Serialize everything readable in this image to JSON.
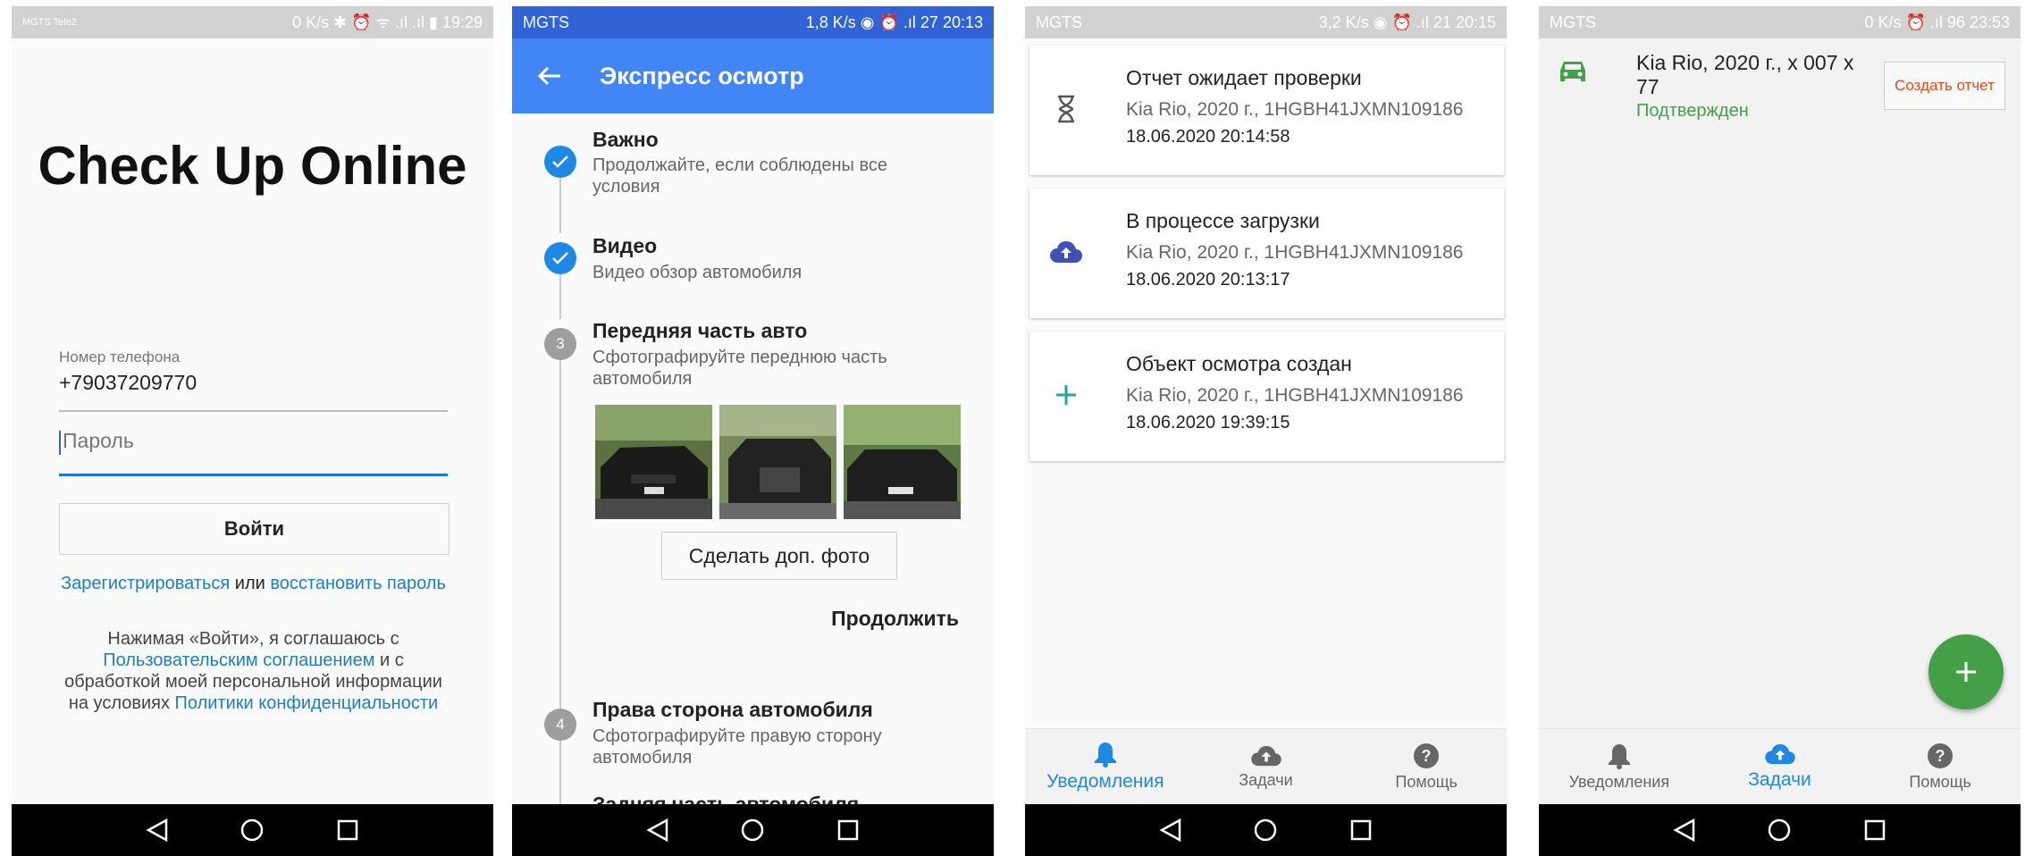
{
  "screens": [
    {
      "status": {
        "left": "MGTS Tele2",
        "right": "0 K/s ✱ ⏰ ᯤ .ıl .ıl ▮ 19:29"
      },
      "logo": "Check Up Online",
      "phone_label": "Номер телефона",
      "phone_value": "+79037209770",
      "password_placeholder": "Пароль",
      "login_button": "Войти",
      "register_link": "Зарегистрироваться",
      "or_text": " или ",
      "restore_link": "восстановить пароль",
      "agree_text_1": "Нажимая «Войти», я соглашаюсь с ",
      "agree_link_1": "Пользовательским соглашением",
      "agree_text_2": " и с обработкой моей персональной информации на условиях ",
      "agree_link_2": "Политики конфиденциальности"
    },
    {
      "status": {
        "left": "MGTS",
        "right": "1,8 K/s ◉ ⏰ .ıl 27 20:13"
      },
      "title": "Экспресс осмотр",
      "steps": [
        {
          "title": "Важно",
          "subtitle": "Продолжайте, если соблюдены все условия"
        },
        {
          "title": "Видео",
          "subtitle": "Видео обзор автомобиля"
        },
        {
          "number": "3",
          "title": "Передняя часть авто",
          "subtitle": "Сфотографируйте переднюю часть автомобиля"
        },
        {
          "number": "4",
          "title": "Права сторона автомобиля",
          "subtitle": "Сфотографируйте правую сторону автомобиля"
        },
        {
          "title": "Задняя часть автомобиля"
        }
      ],
      "extra_photo_button": "Сделать доп. фото",
      "continue_button": "Продолжить"
    },
    {
      "status": {
        "left": "MGTS",
        "right": "3,2 K/s ◉ ⏰ .ıl 21 20:15"
      },
      "cards": [
        {
          "icon": "hourglass-icon",
          "title": "Отчет ожидает проверки",
          "subtitle": "Kia Rio, 2020 г., 1HGBH41JXMN109186",
          "date": "18.06.2020 20:14:58"
        },
        {
          "icon": "cloud-upload-icon",
          "title": "В процессе загрузки",
          "subtitle": "Kia Rio, 2020 г., 1HGBH41JXMN109186",
          "date": "18.06.2020 20:13:17"
        },
        {
          "icon": "plus-icon",
          "title": "Объект осмотра создан",
          "subtitle": "Kia Rio, 2020 г., 1HGBH41JXMN109186",
          "date": "18.06.2020 19:39:15"
        }
      ],
      "nav": {
        "notifications": "Уведомления",
        "tasks": "Задачи",
        "help": "Помощь"
      }
    },
    {
      "status": {
        "left": "MGTS",
        "right": "0 K/s ⏰ .ıl 96 23:53"
      },
      "task_title": "Kia Rio, 2020 г., х 007 х 77",
      "task_status": "Подтвержден",
      "create_report": "Создать отчет",
      "nav": {
        "notifications": "Уведомления",
        "tasks": "Задачи",
        "help": "Помощь"
      }
    }
  ],
  "colors": {
    "primary": "#4285f4",
    "active": "#1e88e5",
    "green": "#43a047",
    "link": "#1a7fc4",
    "orange": "#e64a19"
  }
}
